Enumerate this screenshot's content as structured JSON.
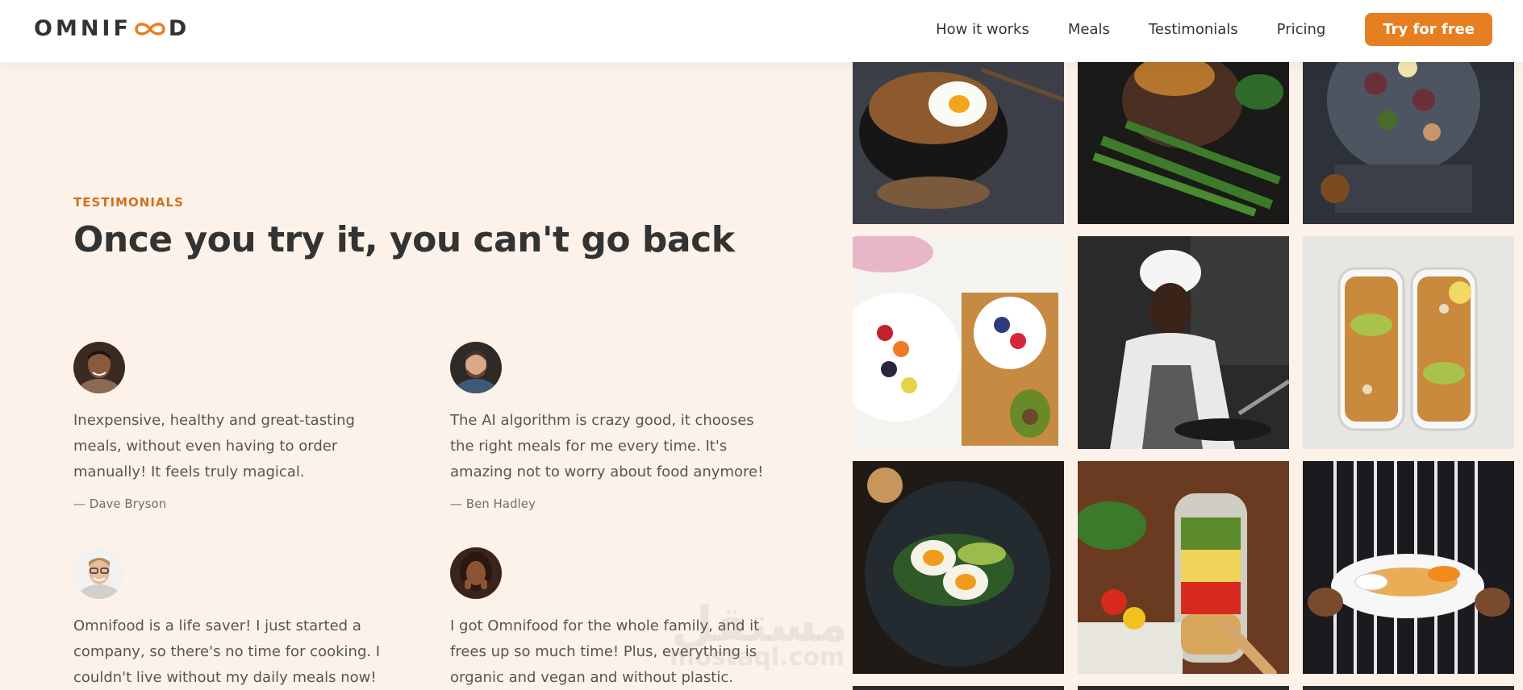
{
  "header": {
    "logo_left": "OMNIF",
    "logo_right": "D",
    "nav": [
      "How it works",
      "Meals",
      "Testimonials",
      "Pricing"
    ],
    "cta": "Try for free"
  },
  "section": {
    "subheading": "TESTIMONIALS",
    "title": "Once you try it, you can't go back"
  },
  "testimonials": [
    {
      "text": "Inexpensive, healthy and great-tasting meals, without even having to order manually! It feels truly magical.",
      "author": "— Dave Bryson"
    },
    {
      "text": "The AI algorithm is crazy good, it chooses the right meals for me every time. It's amazing not to worry about food anymore!",
      "author": "— Ben Hadley"
    },
    {
      "text": "Omnifood is a life saver! I just started a company, so there's no time for cooking. I couldn't live without my daily meals now!",
      "author": ""
    },
    {
      "text": "I got Omnifood for the whole family, and it frees up so much time! Plus, everything is organic and vegan and without plastic.",
      "author": ""
    }
  ],
  "watermark": {
    "arabic": "مستقل",
    "latin": "mostaql.com"
  },
  "colors": {
    "accent": "#e67e22",
    "accent_dark": "#cf711f",
    "background": "#fdf2e9"
  }
}
